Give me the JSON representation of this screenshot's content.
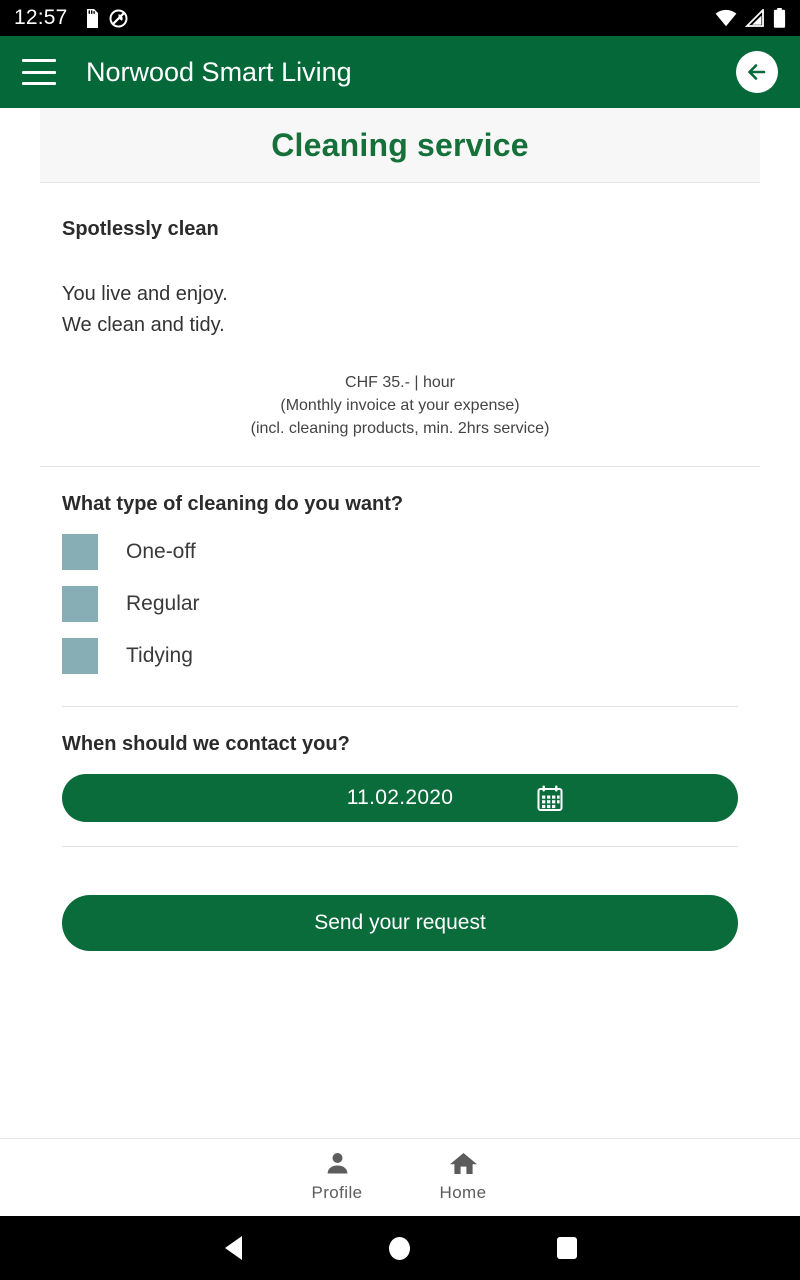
{
  "status_bar": {
    "time": "12:57",
    "icons": [
      "sd-card-icon",
      "location-off-icon",
      "wifi-icon",
      "cellular-signal-icon",
      "battery-icon"
    ]
  },
  "app_bar": {
    "menu_icon": "hamburger-menu-icon",
    "title": "Norwood Smart Living",
    "back_icon": "back-arrow-icon",
    "background_color": "#056839"
  },
  "page": {
    "title": "Cleaning service",
    "title_color": "#15703a",
    "lead": "Spotlessly clean",
    "body_line_1": "You live and enjoy.",
    "body_line_2": "We clean and tidy.",
    "price_line_1": "CHF 35.- | hour",
    "price_line_2": "(Monthly invoice at your expense)",
    "price_line_3": "(incl. cleaning products, min. 2hrs service)"
  },
  "cleaning_type": {
    "question": "What type of cleaning do you want?",
    "checkbox_color": "#86aeb4",
    "options": [
      {
        "label": "One-off",
        "checked": false
      },
      {
        "label": "Regular",
        "checked": false
      },
      {
        "label": "Tidying",
        "checked": false
      }
    ]
  },
  "contact_date": {
    "question": "When should we contact you?",
    "value": "11.02.2020",
    "calendar_icon": "calendar-icon",
    "field_color": "#0a6b3b"
  },
  "submit": {
    "label": "Send your request",
    "color": "#0a6b3b"
  },
  "bottom_nav": {
    "items": [
      {
        "label": "Profile",
        "icon": "person-icon"
      },
      {
        "label": "Home",
        "icon": "house-icon"
      }
    ]
  },
  "android_nav": {
    "back": "back-triangle-icon",
    "home": "home-circle-icon",
    "recents": "recents-square-icon"
  }
}
